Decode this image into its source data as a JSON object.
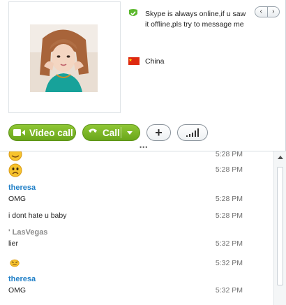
{
  "profile": {
    "mood": "Skype is always online,if u saw it offline,pls try to message me",
    "location": "China",
    "pager": {
      "prev": "‹",
      "next": "›"
    }
  },
  "actions": {
    "video_call": "Video call",
    "call": "Call",
    "add": "+"
  },
  "chat": [
    {
      "type": "emoticon",
      "icon": "sweat-smile-emoticon",
      "time": "5:28 PM"
    },
    {
      "type": "emoticon",
      "icon": "worried-emoticon",
      "time": "5:28 PM"
    },
    {
      "type": "sender",
      "name": "theresa"
    },
    {
      "type": "message",
      "text": "OMG",
      "time": "5:28 PM"
    },
    {
      "type": "message",
      "text": "i dont hate u baby",
      "time": "5:28 PM"
    },
    {
      "type": "sender",
      "name": "' LasVegas",
      "muted": true
    },
    {
      "type": "message",
      "text": "lier",
      "time": "5:32 PM"
    },
    {
      "type": "emoticon",
      "icon": "angry-emoticon",
      "time": "5:32 PM"
    },
    {
      "type": "sender",
      "name": "theresa"
    },
    {
      "type": "message",
      "text": "OMG",
      "time": "5:32 PM"
    }
  ],
  "colors": {
    "accent_green": "#6aa61b",
    "sender_blue": "#1f7fc7",
    "timestamp_grey": "#6f6f6f"
  }
}
